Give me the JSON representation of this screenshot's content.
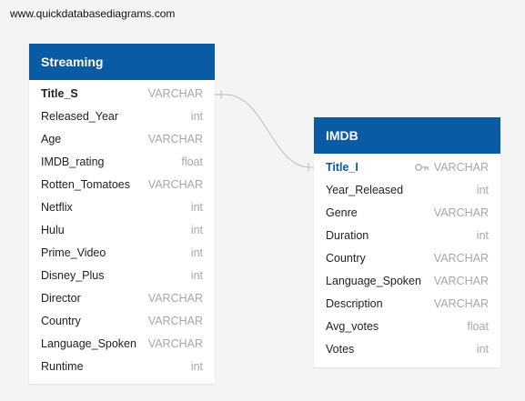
{
  "watermark": "www.quickdatabasediagrams.com",
  "tables": {
    "streaming": {
      "title": "Streaming",
      "fields": [
        {
          "name": "Title_S",
          "type": "VARCHAR"
        },
        {
          "name": "Released_Year",
          "type": "int"
        },
        {
          "name": "Age",
          "type": "VARCHAR"
        },
        {
          "name": "IMDB_rating",
          "type": "float"
        },
        {
          "name": "Rotten_Tomatoes",
          "type": "VARCHAR"
        },
        {
          "name": "Netflix",
          "type": "int"
        },
        {
          "name": "Hulu",
          "type": "int"
        },
        {
          "name": "Prime_Video",
          "type": "int"
        },
        {
          "name": "Disney_Plus",
          "type": "int"
        },
        {
          "name": "Director",
          "type": "VARCHAR"
        },
        {
          "name": "Country",
          "type": "VARCHAR"
        },
        {
          "name": "Language_Spoken",
          "type": "VARCHAR"
        },
        {
          "name": "Runtime",
          "type": "int"
        }
      ]
    },
    "imdb": {
      "title": "IMDB",
      "fields": [
        {
          "name": "Title_I",
          "type": "VARCHAR"
        },
        {
          "name": "Year_Released",
          "type": "int"
        },
        {
          "name": "Genre",
          "type": "VARCHAR"
        },
        {
          "name": "Duration",
          "type": "int"
        },
        {
          "name": "Country",
          "type": "VARCHAR"
        },
        {
          "name": "Language_Spoken",
          "type": "VARCHAR"
        },
        {
          "name": "Description",
          "type": "VARCHAR"
        },
        {
          "name": "Avg_votes",
          "type": "float"
        },
        {
          "name": "Votes",
          "type": "int"
        }
      ]
    }
  },
  "colors": {
    "header": "#0a5aa4",
    "type_text": "#a7a7a7",
    "connector": "#bdbdbd"
  }
}
